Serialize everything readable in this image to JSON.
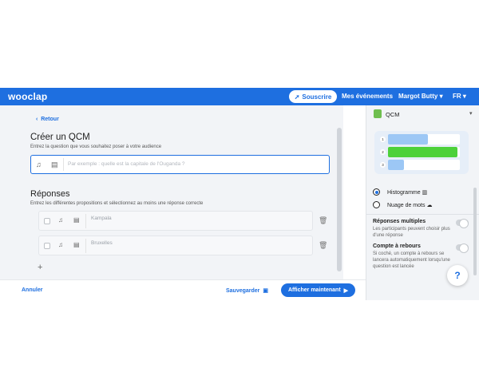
{
  "topbar": {
    "logo": "wooclap",
    "subscribe": "Souscrire",
    "events": "Mes événements",
    "user": "Margot Butty",
    "lang": "FR"
  },
  "editor": {
    "back": "Retour",
    "title": "Créer un QCM",
    "question_help": "Entrez la question que vous souhaitez poser à votre audience",
    "question_placeholder": "Par exemple : quelle est la capitale de l'Ouganda ?",
    "answers_title": "Réponses",
    "answers_help": "Entrez les différentes propositions et sélectionnez au moins une réponse correcte",
    "answers": [
      {
        "placeholder": "Kampala"
      },
      {
        "placeholder": "Bruxelles"
      }
    ]
  },
  "footer": {
    "cancel": "Annuler",
    "save": "Sauvegarder",
    "show_now": "Afficher maintenant"
  },
  "panel": {
    "type": "QCM",
    "preview": [
      {
        "num": "1",
        "fill": 0.55,
        "color": "#9cc7f5"
      },
      {
        "num": "2",
        "fill": 0.97,
        "color": "#4dd13a"
      },
      {
        "num": "3",
        "fill": 0.22,
        "color": "#9cc7f5"
      }
    ],
    "display_options": [
      "Histogramme",
      "Nuage de mots"
    ],
    "selected_display": "Histogramme",
    "settings": [
      {
        "title": "Réponses multiples",
        "desc": "Les participants peuvent choisir plus d'une réponse"
      },
      {
        "title": "Compte à rebours",
        "desc": "Si coché, un compte à rebours se lancera automatiquement lorsqu'une question est lancée"
      }
    ]
  },
  "help": "?",
  "colors": {
    "brand": "#1e6fe0",
    "correct": "#4dd13a"
  }
}
